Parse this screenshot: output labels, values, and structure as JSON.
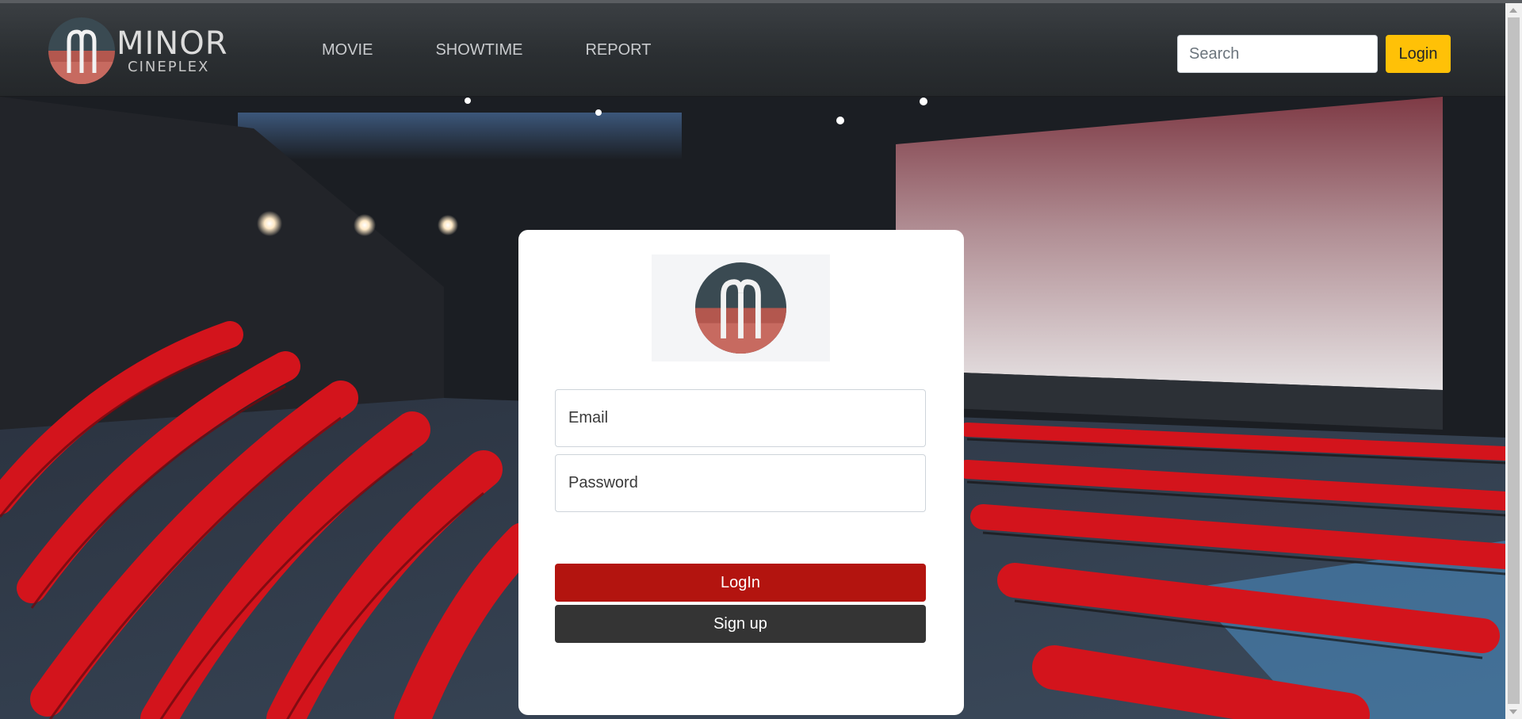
{
  "brand": {
    "name_line1": "MINOR",
    "name_line2": "CINEPLEX"
  },
  "nav": {
    "items": [
      {
        "label": "MOVIE"
      },
      {
        "label": "SHOWTIME"
      },
      {
        "label": "REPORT"
      }
    ],
    "search_placeholder": "Search",
    "login_label": "Login"
  },
  "login_form": {
    "email_placeholder": "Email",
    "password_placeholder": "Password",
    "login_button": "LogIn",
    "signup_button": "Sign up"
  },
  "colors": {
    "accent_yellow": "#ffc107",
    "login_red": "#b3140f",
    "signup_dark": "#343434",
    "seat_red": "#d3141c"
  }
}
